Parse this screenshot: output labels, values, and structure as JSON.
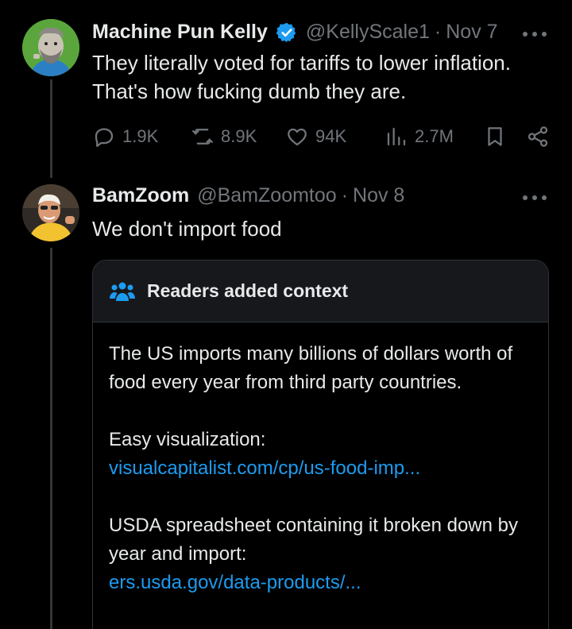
{
  "tweet1": {
    "name": "Machine Pun Kelly",
    "handle": "@KellyScale1",
    "separator": "·",
    "date": "Nov 7",
    "text": "They literally voted for tariffs to lower inflation. That's how fucking dumb they are.",
    "stats": {
      "replies": "1.9K",
      "retweets": "8.9K",
      "likes": "94K",
      "views": "2.7M"
    }
  },
  "tweet2": {
    "name": "BamZoom",
    "handle": "@BamZoomtoo",
    "separator": "·",
    "date": "Nov 8",
    "text": "We don't import food"
  },
  "note": {
    "title": "Readers added context",
    "paragraph1": "The US imports many billions of dollars worth of food every year from third party countries.",
    "label2": "Easy visualization:",
    "link1": "visualcapitalist.com/cp/us-food-imp...",
    "label3": "USDA spreadsheet containing it broken down by year and import:",
    "link2": "ers.usda.gov/data-products/..."
  },
  "colors": {
    "background": "#000000",
    "text": "#e7e9ea",
    "muted": "#71767b",
    "link": "#1d9bf0",
    "border": "#2f3336",
    "verified": "#1d9bf0"
  },
  "icons": [
    "verified-badge-icon",
    "more-icon",
    "reply-icon",
    "retweet-icon",
    "like-icon",
    "views-icon",
    "bookmark-icon",
    "share-icon",
    "community-notes-icon"
  ]
}
